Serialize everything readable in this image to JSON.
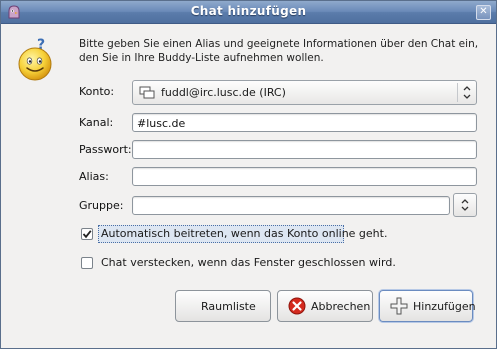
{
  "window": {
    "title": "Chat hinzufügen",
    "close_label": "✕"
  },
  "intro": "Bitte geben Sie einen Alias und geeignete Informationen über den Chat ein, den Sie in Ihre Buddy-Liste aufnehmen wollen.",
  "form": {
    "konto_label": "Konto:",
    "konto_value": "fuddl@irc.lusc.de (IRC)",
    "kanal_label": "Kanal:",
    "kanal_value": "#lusc.de",
    "passwort_label": "Passwort:",
    "passwort_value": "",
    "alias_label": "Alias:",
    "alias_value": "",
    "gruppe_label": "Gruppe:",
    "gruppe_value": ""
  },
  "options": {
    "auto_join_label": "Automatisch beitreten, wenn das Konto online geht.",
    "auto_join_checked": true,
    "hide_chat_label": "Chat verstecken, wenn das Fenster geschlossen wird.",
    "hide_chat_checked": false
  },
  "buttons": {
    "room_list": "Raumliste",
    "cancel": "Abbrechen",
    "add": "Hinzufügen"
  },
  "icons": {
    "app": "pidgin-icon",
    "dialog": "smiley-question-icon",
    "account": "irc-account-icon",
    "cancel": "cancel-icon",
    "add": "plus-icon"
  },
  "colors": {
    "titlebar": "#5b7cab",
    "cancel_icon": "#d42a1e"
  }
}
